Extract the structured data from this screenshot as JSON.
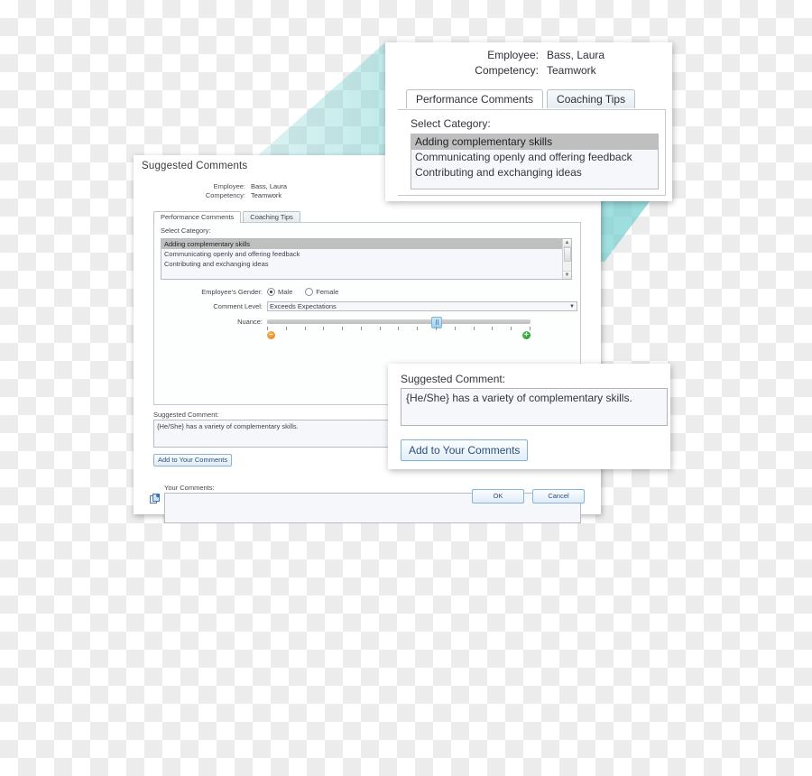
{
  "window": {
    "title": "Suggested Comments",
    "header": [
      {
        "label": "Employee:",
        "value": "Bass, Laura"
      },
      {
        "label": "Competency:",
        "value": "Teamwork"
      }
    ],
    "tabs": [
      {
        "label": "Performance Comments",
        "active": true
      },
      {
        "label": "Coaching Tips",
        "active": false
      }
    ],
    "select_category_label": "Select Category:",
    "categories": [
      {
        "text": "Adding complementary skills",
        "selected": true
      },
      {
        "text": "Communicating openly and offering feedback",
        "selected": false
      },
      {
        "text": "Contributing and exchanging ideas",
        "selected": false
      }
    ],
    "gender": {
      "label": "Employee's Gender:",
      "options": [
        {
          "label": "Male",
          "checked": true
        },
        {
          "label": "Female",
          "checked": false
        }
      ]
    },
    "comment_level": {
      "label": "Comment Level:",
      "value": "Exceeds Expectations"
    },
    "nuance": {
      "label": "Nuance:",
      "minus_glyph": "−",
      "plus_glyph": "+",
      "tick_count": 15,
      "value_percent": 62
    },
    "suggested_comment": {
      "label": "Suggested Comment:",
      "value": "{He/She} has a variety of complementary skills."
    },
    "add_button_label": "Add to Your Comments",
    "your_comments": {
      "label": "Your Comments:",
      "value": ""
    },
    "footer": {
      "ok_label": "OK",
      "cancel_label": "Cancel"
    }
  },
  "callout_top": {
    "header": [
      {
        "label": "Employee:",
        "value": "Bass, Laura"
      },
      {
        "label": "Competency:",
        "value": "Teamwork"
      }
    ],
    "tabs": [
      {
        "label": "Performance Comments",
        "active": true
      },
      {
        "label": "Coaching Tips",
        "active": false
      }
    ],
    "select_category_label": "Select Category:",
    "categories": [
      {
        "text": "Adding complementary skills",
        "selected": true
      },
      {
        "text": "Communicating openly and offering feedback",
        "selected": false
      },
      {
        "text": "Contributing and exchanging ideas",
        "selected": false
      }
    ]
  },
  "callout_bottom": {
    "label": "Suggested Comment:",
    "value": "{He/She} has a variety of complementary skills.",
    "button_label": "Add to Your Comments"
  },
  "colors": {
    "beam": "#6ececf",
    "selection": "#bfbfbf",
    "button_text": "#2d4f7c",
    "minus_badge": "#e8811b",
    "plus_badge": "#168c24",
    "slider_thumb": "#9ccdea",
    "checker_light": "#ffffff",
    "checker_dark": "#ececec"
  }
}
